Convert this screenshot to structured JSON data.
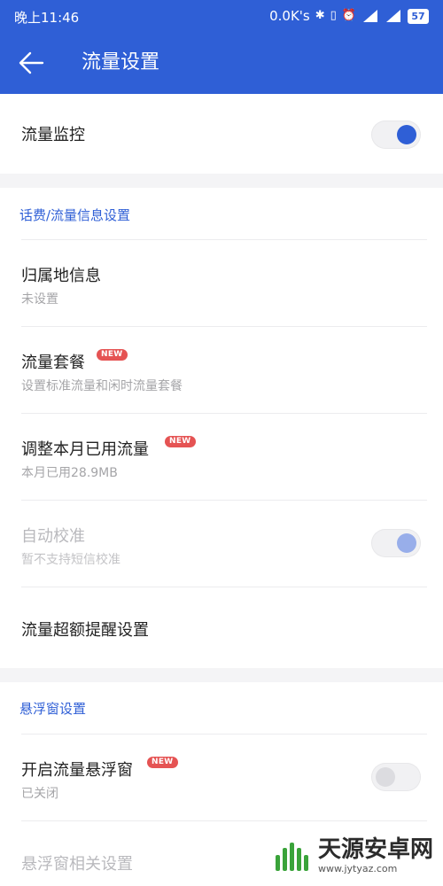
{
  "status_bar": {
    "time": "晚上11:46",
    "speed": "0.0K's",
    "icons": [
      "bluetooth-icon",
      "vibrate-icon",
      "alarm-icon",
      "signal-3g-icon",
      "signal-4g-icon"
    ],
    "battery": "57"
  },
  "header": {
    "title": "流量设置",
    "back_icon": "arrow-left-icon",
    "bg_color": "#2f5fd6"
  },
  "monitor": {
    "label": "流量监控",
    "enabled": true
  },
  "sections": {
    "info": {
      "label": "话费/流量信息设置"
    },
    "floating": {
      "label": "悬浮窗设置"
    }
  },
  "rows": {
    "location": {
      "title": "归属地信息",
      "subtitle": "未设置"
    },
    "plan": {
      "title": "流量套餐",
      "subtitle": "设置标准流量和闲时流量套餐",
      "badge": "NEW"
    },
    "adjust": {
      "title": "调整本月已用流量",
      "subtitle": "本月已用28.9MB",
      "badge": "NEW"
    },
    "auto_calibrate": {
      "title": "自动校准",
      "subtitle": "暂不支持短信校准",
      "enabled": true,
      "disabled": true
    },
    "overlimit": {
      "title": "流量超额提醒设置"
    },
    "floating_window": {
      "title": "开启流量悬浮窗",
      "subtitle": "已关闭",
      "badge": "NEW",
      "enabled": false
    },
    "floating_settings": {
      "title": "悬浮窗相关设置"
    }
  },
  "watermark": {
    "text": "天源安卓网",
    "url": "www.jytyaz.com"
  },
  "colors": {
    "accent": "#2f5fd6",
    "badge": "#e55353",
    "background": "#f4f4f6"
  }
}
